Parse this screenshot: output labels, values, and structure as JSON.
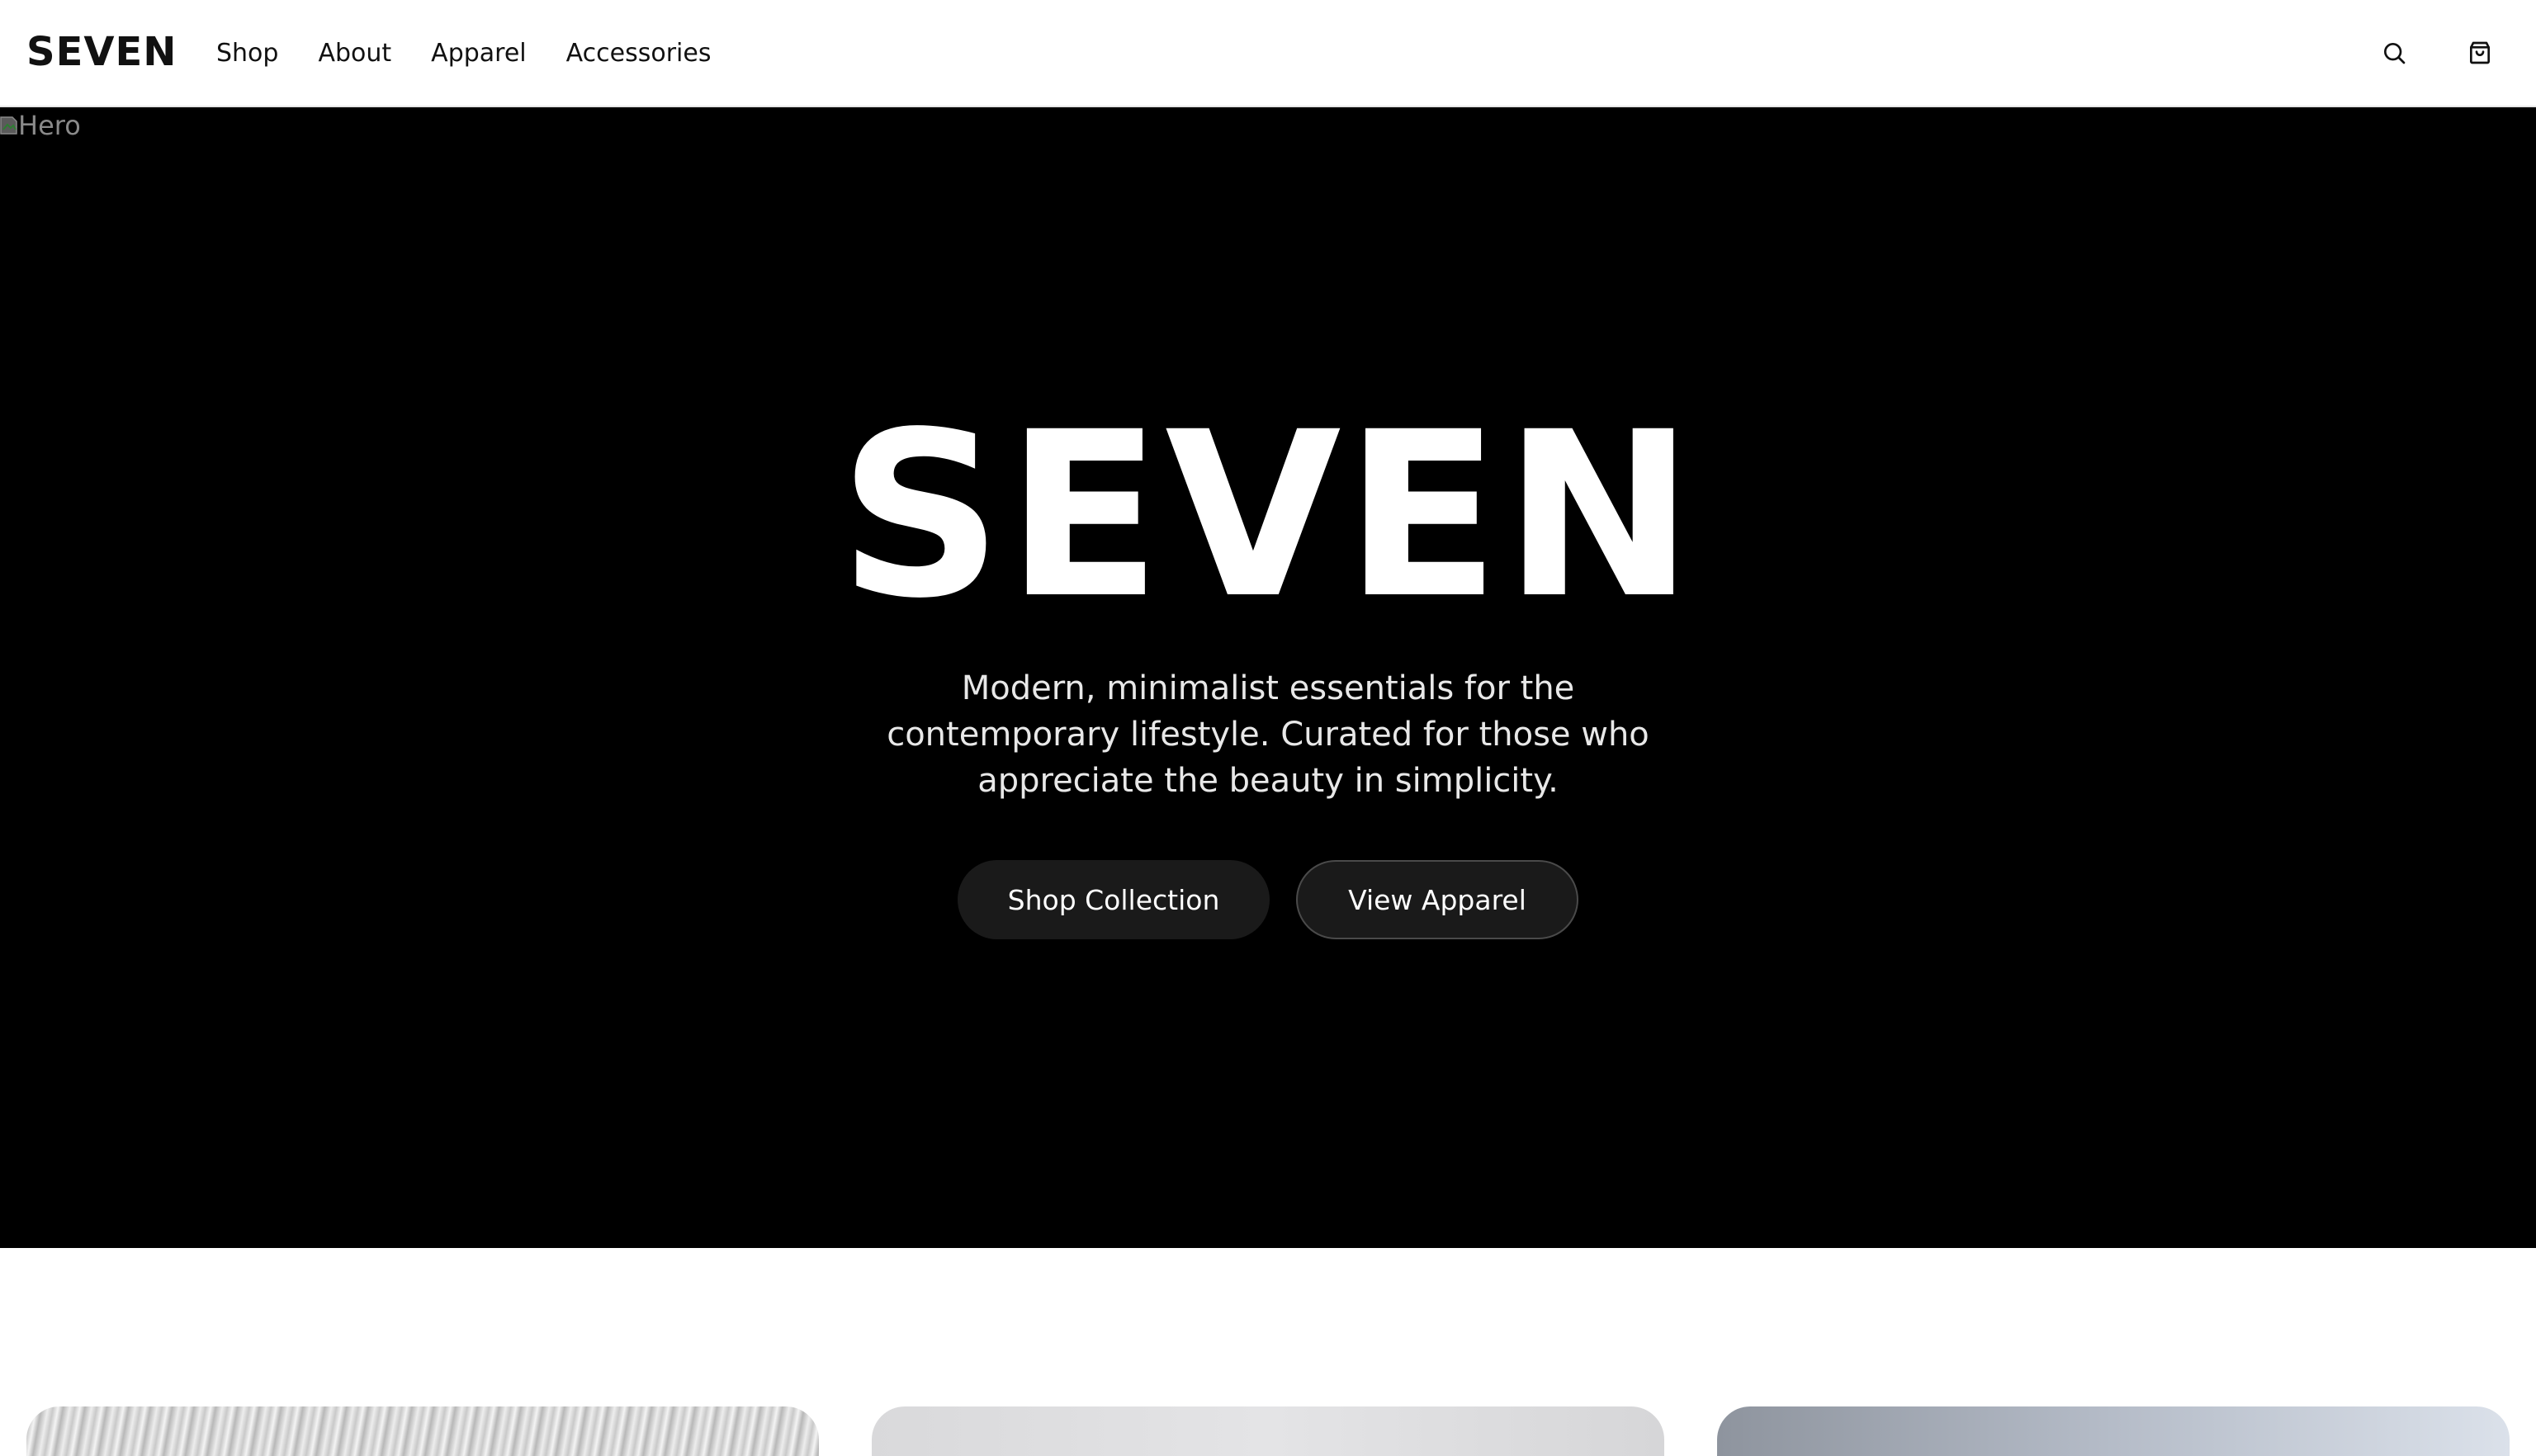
{
  "header": {
    "logo": "SEVEN",
    "nav": [
      {
        "label": "Shop"
      },
      {
        "label": "About"
      },
      {
        "label": "Apparel"
      },
      {
        "label": "Accessories"
      }
    ],
    "search_icon": "search-icon",
    "cart_icon": "shopping-bag-icon"
  },
  "hero": {
    "image_alt": "Hero",
    "title": "SEVEN",
    "subtitle": "Modern, minimalist essentials for the contemporary lifestyle. Curated for those who appreciate the beauty in simplicity.",
    "primary_button": "Shop Collection",
    "secondary_button": "View Apparel",
    "background_color": "#000000"
  },
  "colors": {
    "text_dark": "#111111",
    "button_bg": "#1a1a1a",
    "hero_text": "#ffffff"
  }
}
